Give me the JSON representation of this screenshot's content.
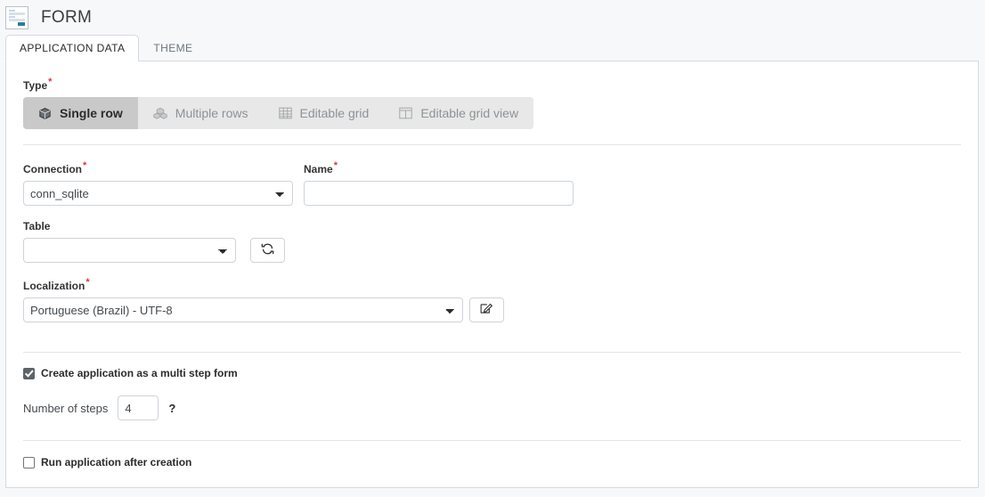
{
  "header": {
    "title": "FORM",
    "icon": "form-document-icon"
  },
  "tabs": [
    {
      "label": "APPLICATION DATA",
      "active": true
    },
    {
      "label": "THEME",
      "active": false
    }
  ],
  "form": {
    "type": {
      "label": "Type",
      "required": "*",
      "options": [
        {
          "label": "Single row",
          "icon": "cube-icon",
          "selected": true
        },
        {
          "label": "Multiple rows",
          "icon": "multiple-cubes-icon",
          "selected": false
        },
        {
          "label": "Editable grid",
          "icon": "table-grid-icon",
          "selected": false
        },
        {
          "label": "Editable grid view",
          "icon": "split-panel-icon",
          "selected": false
        }
      ]
    },
    "connection": {
      "label": "Connection",
      "required": "*",
      "value": "conn_sqlite"
    },
    "name": {
      "label": "Name",
      "required": "*",
      "value": "",
      "placeholder": ""
    },
    "table": {
      "label": "Table",
      "value": "",
      "refresh_icon": "refresh-icon"
    },
    "localization": {
      "label": "Localization",
      "required": "*",
      "value": "Portuguese (Brazil) - UTF-8",
      "edit_icon": "edit-icon"
    },
    "multi_step": {
      "label": "Create application as a multi step form",
      "checked": true
    },
    "steps": {
      "label": "Number of steps",
      "value": "4",
      "help": "?"
    },
    "run_after_creation": {
      "label": "Run application after creation",
      "checked": false
    }
  },
  "colors": {
    "page_background": "#f7f8fa",
    "panel_background": "#ffffff",
    "border": "#d6d9dc",
    "required_asterisk": "#dc3545",
    "selected_type_background": "#c9c9c9",
    "type_group_background": "#e8e8e8",
    "accent_icon": "#2d7d9a"
  }
}
